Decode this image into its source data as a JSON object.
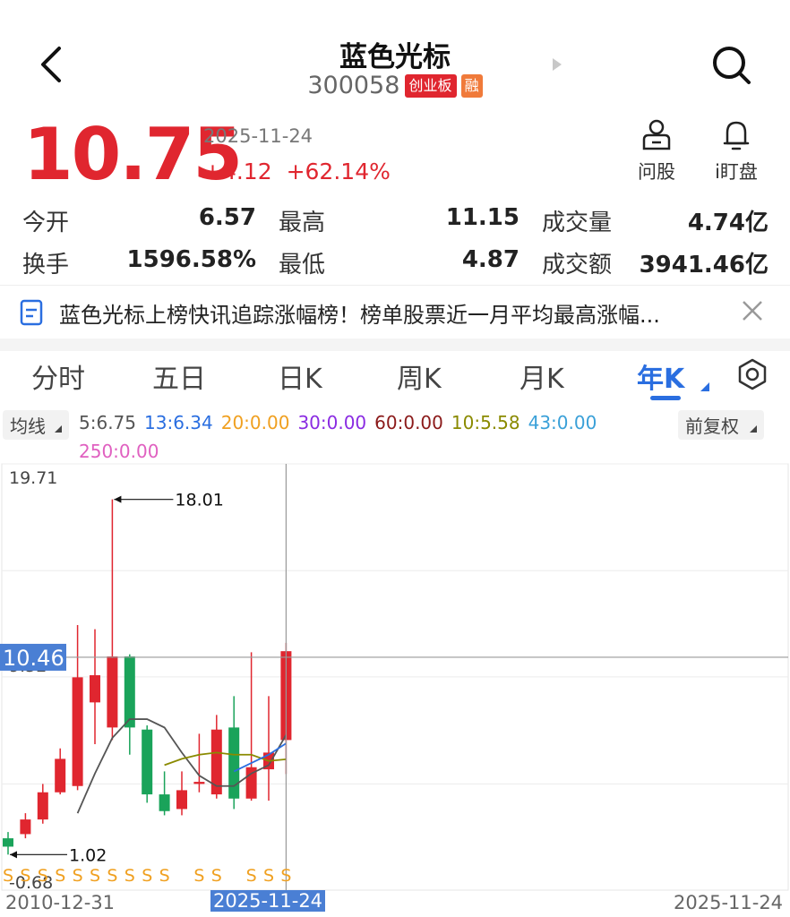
{
  "header": {
    "title": "蓝色光标",
    "code": "300058",
    "board_badge": "创业板",
    "margin_badge": "融"
  },
  "quote": {
    "price": "10.75",
    "date": "2025-11-24",
    "change": "+4.12",
    "change_pct": "+62.14%"
  },
  "actions": {
    "ask_label": "问股",
    "watch_label": "i盯盘"
  },
  "stats": {
    "open_label": "今开",
    "open_value": "6.57",
    "high_label": "最高",
    "high_value": "11.15",
    "volume_label": "成交量",
    "volume_value": "4.74亿",
    "turnover_label": "换手",
    "turnover_value": "1596.58%",
    "low_label": "最低",
    "low_value": "4.87",
    "amount_label": "成交额",
    "amount_value": "3941.46亿"
  },
  "news": {
    "text": "蓝色光标上榜快讯追踪涨幅榜！榜单股票近一月平均最高涨幅..."
  },
  "tabs": [
    "分时",
    "五日",
    "日K",
    "周K",
    "月K",
    "年K"
  ],
  "active_tab": "年K",
  "ma": {
    "selector_label": "均线",
    "adjust_label": "前复权",
    "items": [
      {
        "text": "5:6.75",
        "color": "#555555"
      },
      {
        "text": "13:6.34",
        "color": "#2a6ee0"
      },
      {
        "text": "20:0.00",
        "color": "#f0a020"
      },
      {
        "text": "30:0.00",
        "color": "#8a2be2"
      },
      {
        "text": "60:0.00",
        "color": "#8b1a1a"
      },
      {
        "text": "10:5.58",
        "color": "#8a8a00"
      },
      {
        "text": "43:0.00",
        "color": "#3aa0d8"
      }
    ],
    "item_250": {
      "text": "250:0.00",
      "color": "#e060c0"
    }
  },
  "chart_data": {
    "type": "candlestick",
    "y_axis_labels": [
      "19.71",
      "9.52",
      "-0.68"
    ],
    "ylim": [
      -0.68,
      19.71
    ],
    "crosshair_value": "10.46",
    "max_annotation": "18.01",
    "min_annotation": "1.02",
    "x_start_label": "2010-12-31",
    "x_cursor_label": "2025-11-24",
    "x_end_label": "2025-11-24",
    "candles": [
      {
        "o": 1.8,
        "c": 1.4,
        "h": 2.1,
        "l": 1.02
      },
      {
        "o": 2.0,
        "c": 2.7,
        "h": 3.0,
        "l": 1.8
      },
      {
        "o": 2.7,
        "c": 4.0,
        "h": 4.4,
        "l": 2.5
      },
      {
        "o": 4.0,
        "c": 5.6,
        "h": 6.1,
        "l": 3.9
      },
      {
        "o": 4.3,
        "c": 9.5,
        "h": 12.0,
        "l": 4.1
      },
      {
        "o": 8.3,
        "c": 9.6,
        "h": 11.8,
        "l": 6.3
      },
      {
        "o": 7.1,
        "c": 10.5,
        "h": 18.01,
        "l": 6.5
      },
      {
        "o": 10.5,
        "c": 7.1,
        "h": 10.6,
        "l": 5.8
      },
      {
        "o": 7.0,
        "c": 3.9,
        "h": 7.2,
        "l": 3.5
      },
      {
        "o": 3.9,
        "c": 3.1,
        "h": 5.0,
        "l": 2.9
      },
      {
        "o": 3.2,
        "c": 4.1,
        "h": 5.0,
        "l": 2.9
      },
      {
        "o": 4.4,
        "c": 4.5,
        "h": 6.8,
        "l": 4.0
      },
      {
        "o": 3.9,
        "c": 7.0,
        "h": 7.7,
        "l": 3.7
      },
      {
        "o": 7.1,
        "c": 3.7,
        "h": 8.6,
        "l": 3.2
      },
      {
        "o": 3.7,
        "c": 5.2,
        "h": 10.7,
        "l": 3.6
      },
      {
        "o": 5.1,
        "c": 5.9,
        "h": 8.6,
        "l": 3.6
      },
      {
        "o": 6.5,
        "c": 10.75,
        "h": 11.15,
        "l": 4.87
      }
    ],
    "ma5": [
      null,
      null,
      null,
      null,
      3.0,
      4.9,
      6.6,
      7.5,
      7.5,
      7.1,
      5.9,
      4.8,
      4.3,
      4.3,
      4.9,
      5.3,
      6.75
    ],
    "ma10": [
      null,
      null,
      null,
      null,
      null,
      null,
      null,
      null,
      null,
      5.3,
      5.6,
      5.8,
      5.9,
      5.8,
      5.8,
      5.5,
      5.58
    ],
    "ma13": [
      null,
      null,
      null,
      null,
      null,
      null,
      null,
      null,
      null,
      null,
      null,
      null,
      null,
      5.0,
      5.4,
      5.8,
      6.34
    ],
    "signal_marks": [
      "S",
      "S",
      "S",
      "S",
      "S",
      "S",
      "S",
      "S",
      "S",
      "S",
      "S",
      "S",
      "S",
      "S",
      "S",
      "S",
      "S"
    ],
    "signal_mark_show": [
      true,
      true,
      true,
      true,
      true,
      true,
      true,
      true,
      true,
      true,
      false,
      true,
      true,
      false,
      true,
      true,
      true
    ]
  }
}
